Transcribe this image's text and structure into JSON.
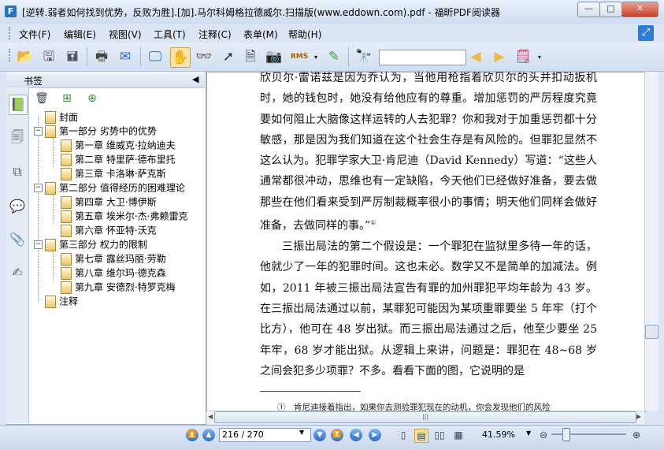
{
  "window": {
    "title": "[逆转.弱者如何找到优势，反败为胜].[加].马尔科姆格拉德威尔.扫描版(www.eddown.com).pdf - 福昕PDF阅读器",
    "min_glyph": "—",
    "max_glyph": "□",
    "close_glyph": "✕"
  },
  "menu": {
    "file": "文件(F)",
    "edit": "编辑(E)",
    "view": "视图(V)",
    "tools": "工具(T)",
    "comment": "注释(C)",
    "form": "表单(M)",
    "help": "帮助(H)"
  },
  "toolbar": {
    "search_value": "",
    "rms_label": "RMS"
  },
  "sidebar": {
    "title": "书签",
    "tree": [
      {
        "label": "封面",
        "level": 0
      },
      {
        "label": "第一部分 劣势中的优势",
        "level": 0,
        "expanded": true
      },
      {
        "label": "第一章 维威克·拉纳迪夫",
        "level": 1
      },
      {
        "label": "第二章 特里萨·德布里托",
        "level": 1
      },
      {
        "label": "第三章 卡洛琳·萨克斯",
        "level": 1
      },
      {
        "label": "第二部分 值得经历的困难理论",
        "level": 0,
        "expanded": true
      },
      {
        "label": "第四章 大卫·博伊斯",
        "level": 1
      },
      {
        "label": "第五章 埃米尔·杰·弗赖雷克",
        "level": 1
      },
      {
        "label": "第六章 怀亚特·沃克",
        "level": 1
      },
      {
        "label": "第三部分 权力的限制",
        "level": 0,
        "expanded": true
      },
      {
        "label": "第七章 露丝玛丽·劳勒",
        "level": 1
      },
      {
        "label": "第八章 维尔玛·德克森",
        "level": 1
      },
      {
        "label": "第九章 安德烈·特罗克梅",
        "level": 1
      },
      {
        "label": "注释",
        "level": 0
      }
    ]
  },
  "document": {
    "paragraph1": "欣贝尔·雷诺兹是因为乔认为，当他用枪指着欣贝尔的头并扣动扳机时，她的钱包时，她没有给他应有的尊重。增加惩罚的严厉程度究竟要如何阻止大脑像这样运转的人去犯罪？你和我对于加重惩罚都十分敏感，那是因为我们知道在这个社会生存是有风险的。但罪犯显然不这么认为。犯罪学家大卫·肯尼迪（David Kennedy）写道：“这些人通常都很冲动，思维也有一定缺陷，今天他们已经做好准备，要去做那些在他们看来受到严厉制裁概率很小的事情；明天他们同样会做好准备，去做同样的事。”",
    "footnote_mark": "①",
    "paragraph2": "三振出局法的第二个假设是：一个罪犯在监狱里多待一年的话，他就少了一年的犯罪时间。这也未必。数学又不是简单的加减法。例如，2011 年被三振出局法宣告有罪的加州罪犯平均年龄为 43 岁。在三振出局法通过以前，某罪犯可能因为某项重罪要坐 5 年牢（打个比方），他可在 48 岁出狱。而三振出局法通过之后，他至少要坐 25 年牢，68 岁才能出狱。从逻辑上来讲，问题是：罪犯在 48~68 岁之间会犯多少项罪？不多。看看下面的图，它说明的是",
    "footnote": "①　肯尼迪接着指出，如果你去测验罪犯现在的动机，你会发现他们的风险"
  },
  "status": {
    "page_field": "216 / 270",
    "zoom": "41.59%"
  }
}
